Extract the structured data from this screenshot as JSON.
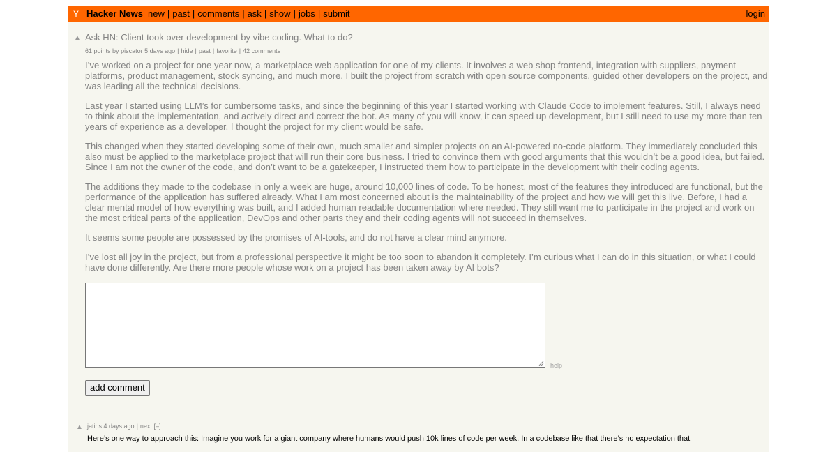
{
  "header": {
    "logo": "Y",
    "site_name": "Hacker News",
    "nav": [
      "new",
      "past",
      "comments",
      "ask",
      "show",
      "jobs",
      "submit"
    ],
    "login": "login"
  },
  "story": {
    "title": "Ask HN: Client took over development by vibe coding. What to do?",
    "points": "61 points",
    "by": "by",
    "user": "piscator",
    "age": "5 days ago",
    "links": [
      "hide",
      "past",
      "favorite",
      "42 comments"
    ],
    "paragraphs": [
      "I’ve worked on a project for one year now, a marketplace web application for one of my clients. It involves a web shop frontend, integration with suppliers, payment platforms, product management, stock syncing, and much more. I built the project from scratch with open source components, guided other developers on the project, and was leading all the technical decisions.",
      "Last year I started using LLM’s for cumbersome tasks, and since the beginning of this year I started working with Claude Code to implement features. Still, I always need to think about the implementation, and actively direct and correct the bot. As many of you will know, it can speed up development, but I still need to use my more than ten years of experience as a developer. I thought the project for my client would be safe.",
      "This changed when they started developing some of their own, much smaller and simpler projects on an AI-powered no-code platform. They immediately concluded this also must be applied to the marketplace project that will run their core business. I tried to convince them with good arguments that this wouldn’t be a good idea, but failed. Since I am not the owner of the code, and don’t want to be a gatekeeper, I instructed them how to participate in the development with their coding agents.",
      "The additions they made to the codebase in only a week are huge, around 10,000 lines of code. To be honest, most of the features they introduced are functional, but the performance of the application has suffered already. What I am most concerned about is the maintainability of the project and how we will get this live. Before, I had a clear mental model of how everything was built, and I added human readable documentation where needed. They still want me to participate in the project and work on the most critical parts of the application, DevOps and other parts they and their coding agents will not succeed in themselves.",
      "It seems some people are possessed by the promises of AI-tools, and do not have a clear mind anymore.",
      "I’ve lost all joy in the project, but from a professional perspective it might be too soon to abandon it completely. I’m curious what I can do in this situation, or what I could have done differently. Are there more people whose work on a project has been taken away by AI bots?"
    ]
  },
  "reply": {
    "help": "help",
    "button": "add comment"
  },
  "comment": {
    "user": "jatins",
    "age": "4 days ago",
    "next": "next",
    "collapse": "[–]",
    "text": "Here’s one way to approach this: Imagine you work for a giant company where humans would push 10k lines of code per week. In a codebase like that there’s no expectation that"
  },
  "icons": {
    "vote": "upvote-arrow-icon",
    "resize": "resize-grip-icon"
  },
  "colors": {
    "header": "#ff6600",
    "background": "#f6f6ef",
    "muted_text": "#828282"
  }
}
